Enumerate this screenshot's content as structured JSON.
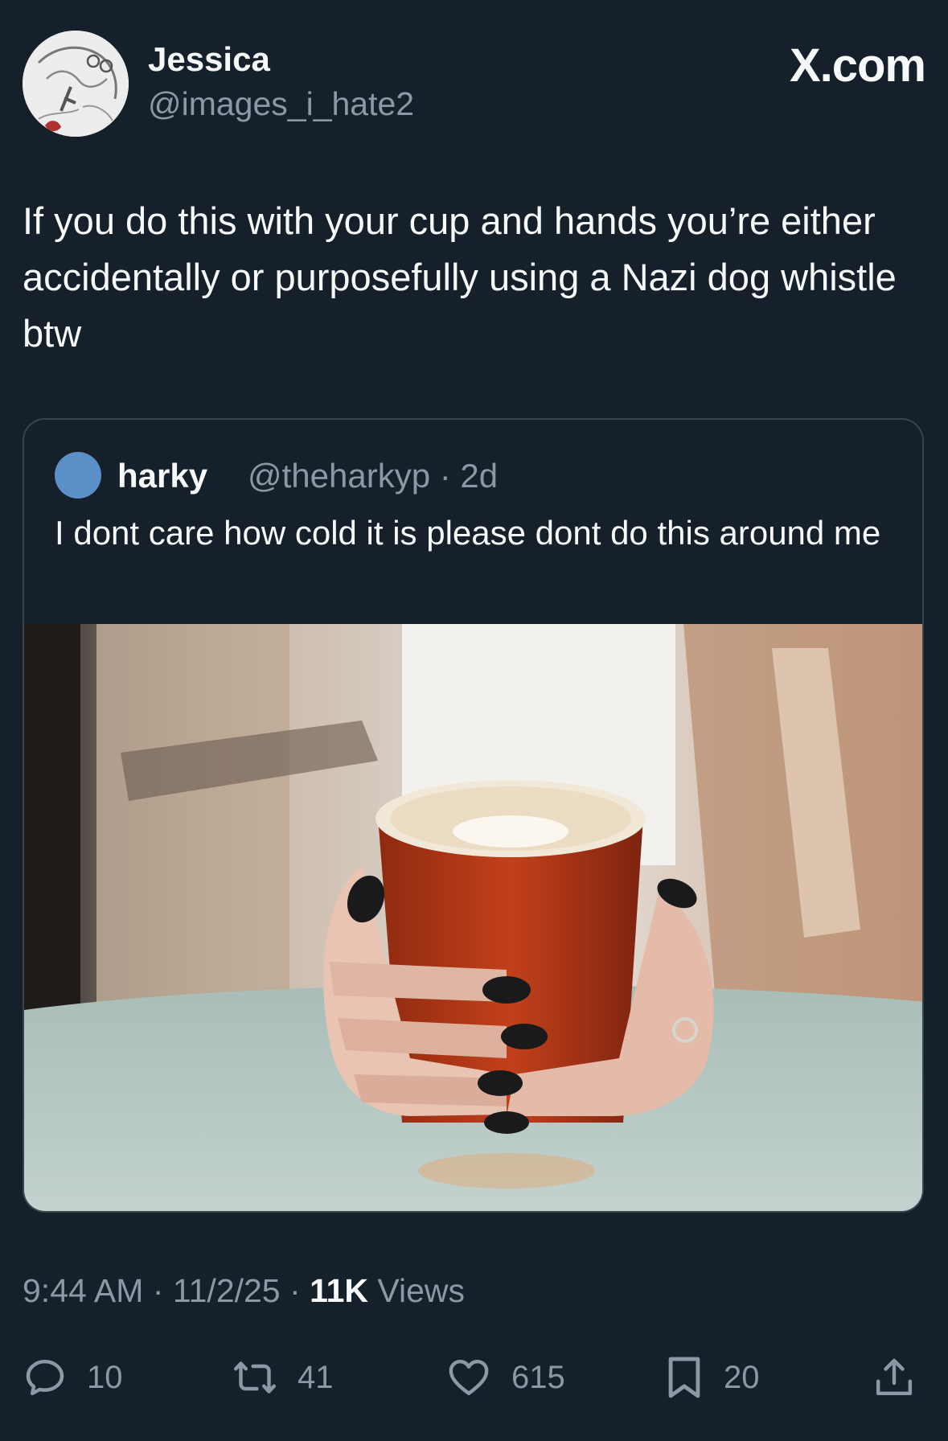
{
  "author": {
    "display_name": "Jessica",
    "handle": "@images_i_hate2",
    "avatar_icon": "sketch-avatar"
  },
  "source_label": "X.com",
  "tweet": {
    "text": "If you do this with your cup and hands you’re either accidentally or purposefully using a Nazi dog whistle btw"
  },
  "quote": {
    "display_name": "harky",
    "handle_time": "@theharkyp · 2d",
    "text": "I dont care how cold it is please dont do this around me",
    "image_description_icon": "photo-hands-holding-cup"
  },
  "meta": {
    "time_date": "9:44 AM · 11/2/25 · ",
    "views_count": "11K",
    "views_label": " Views"
  },
  "actions": {
    "reply_count": "10",
    "repost_count": "41",
    "like_count": "615",
    "bookmark_count": "20"
  },
  "colors": {
    "background": "#15202b",
    "text_primary": "#f7f9f9",
    "text_secondary": "#8b98a5",
    "border": "#38444d"
  }
}
